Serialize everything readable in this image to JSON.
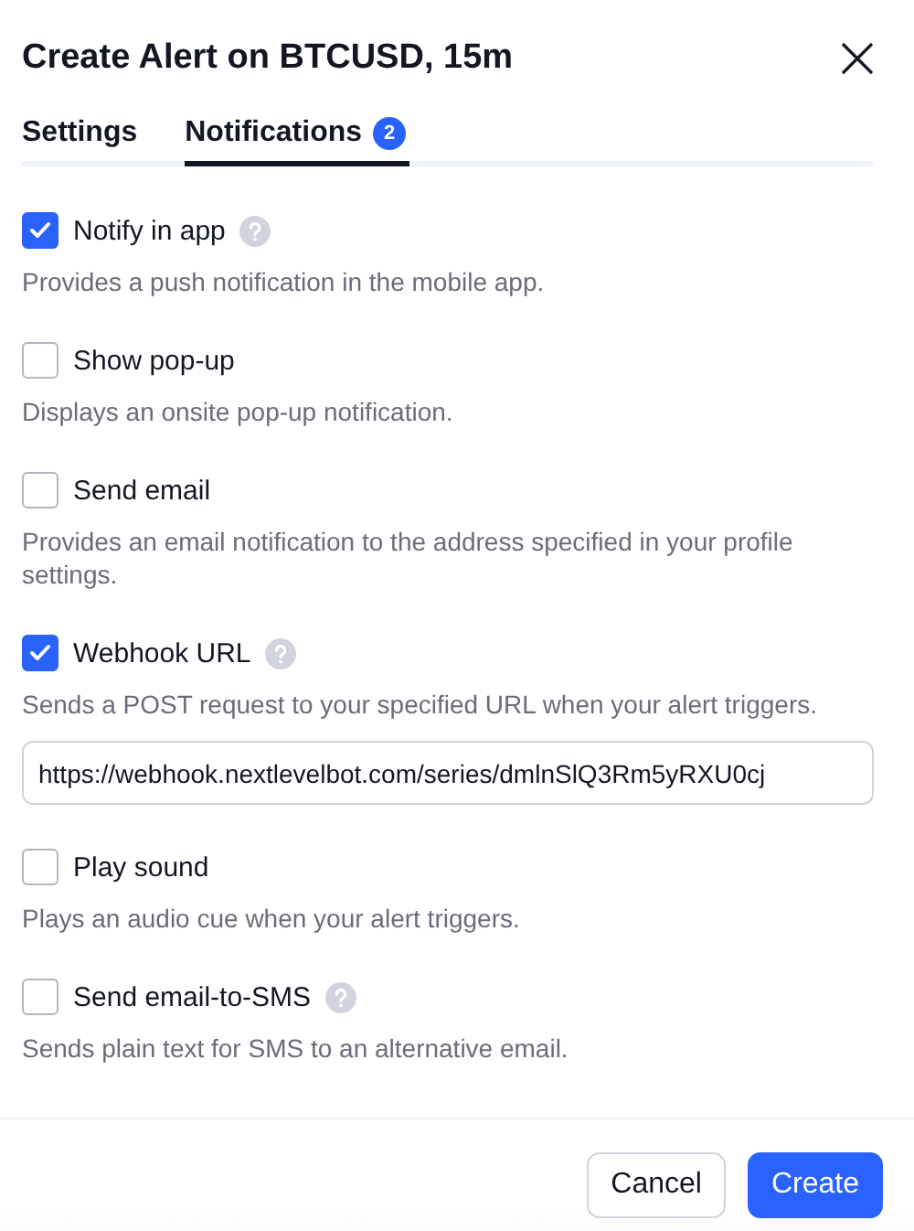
{
  "dialog": {
    "title": "Create Alert on BTCUSD, 15m"
  },
  "tabs": [
    {
      "label": "Settings",
      "selected": false
    },
    {
      "label": "Notifications",
      "selected": true,
      "badge": "2"
    }
  ],
  "options": [
    {
      "label": "Notify in app",
      "checked": true,
      "help": true,
      "description": "Provides a push notification in the mobile app."
    },
    {
      "label": "Show pop-up",
      "checked": false,
      "help": false,
      "description": "Displays an onsite pop-up notification."
    },
    {
      "label": "Send email",
      "checked": false,
      "help": false,
      "description": "Provides an email notification to the address specified in your profile settings."
    },
    {
      "label": "Webhook URL",
      "checked": true,
      "help": true,
      "description": "Sends a POST request to your specified URL when your alert triggers.",
      "value": "https://webhook.nextlevelbot.com/series/dmlnSlQ3Rm5yRXU0cj"
    },
    {
      "label": "Play sound",
      "checked": false,
      "help": false,
      "description": "Plays an audio cue when your alert triggers."
    },
    {
      "label": "Send email-to-SMS",
      "checked": false,
      "help": true,
      "description": "Sends plain text for SMS to an alternative email."
    }
  ],
  "buttons": [
    {
      "label": "Cancel",
      "kind": "secondary"
    },
    {
      "label": "Create",
      "kind": "primary"
    }
  ]
}
